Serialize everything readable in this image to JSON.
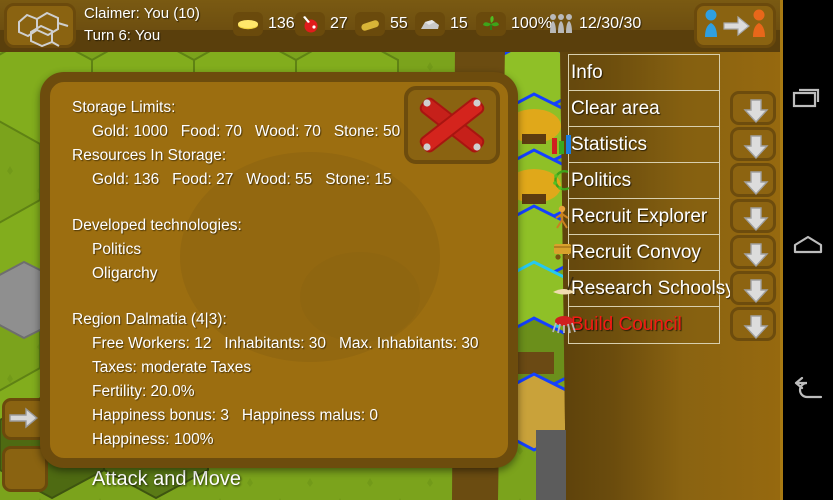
{
  "topbar": {
    "logo_icon": "hex-map-icon",
    "claimer": "Claimer: You (10)",
    "turn": "Turn 6: You",
    "resources": [
      {
        "icon": "gold-coin-icon",
        "name": "gold",
        "value": "136"
      },
      {
        "icon": "food-meat-icon",
        "name": "food",
        "value": "27"
      },
      {
        "icon": "wood-log-icon",
        "name": "wood",
        "value": "55"
      },
      {
        "icon": "stone-rock-icon",
        "name": "stone",
        "value": "15"
      },
      {
        "icon": "plant-icon",
        "name": "fertility",
        "value": "100%"
      },
      {
        "icon": "population-icon",
        "name": "population",
        "value": "12/30/30"
      }
    ],
    "end_turn_icon": "end-turn-pawns-icon"
  },
  "dialog": {
    "close_icon": "red-cross-close-icon",
    "lines": [
      {
        "text": "Storage Limits:",
        "indent": false
      },
      {
        "text": "Gold: 1000   Food: 70   Wood: 70   Stone: 50",
        "indent": true
      },
      {
        "text": "Resources In Storage:",
        "indent": false
      },
      {
        "text": "Gold: 136   Food: 27   Wood: 55   Stone: 15",
        "indent": true
      },
      {
        "text": "",
        "indent": false
      },
      {
        "text": "Developed technologies:",
        "indent": false
      },
      {
        "text": "Politics",
        "indent": true
      },
      {
        "text": "Oligarchy",
        "indent": true
      },
      {
        "text": "",
        "indent": false
      },
      {
        "text": "Region Dalmatia (4|3):",
        "indent": false
      },
      {
        "text": "Free Workers: 12   Inhabitants: 30   Max. Inhabitants: 30",
        "indent": true
      },
      {
        "text": "Taxes: moderate Taxes",
        "indent": true
      },
      {
        "text": "Fertility: 20.0%",
        "indent": true
      },
      {
        "text": "Happiness bonus: 3   Happiness malus: 0",
        "indent": true
      },
      {
        "text": "Happiness: 100%",
        "indent": true
      }
    ]
  },
  "menu": {
    "items": [
      {
        "label": "Info",
        "icon": "",
        "red": false,
        "has_arrow": false
      },
      {
        "label": "Clear area",
        "icon": "",
        "red": false,
        "has_arrow": true
      },
      {
        "label": "Statistics",
        "icon": "bar-chart-icon",
        "red": false,
        "has_arrow": true
      },
      {
        "label": "Politics",
        "icon": "laurel-wreath-icon",
        "red": false,
        "has_arrow": true
      },
      {
        "label": "Recruit Explorer",
        "icon": "explorer-icon",
        "red": false,
        "has_arrow": true
      },
      {
        "label": "Recruit Convoy",
        "icon": "convoy-cart-icon",
        "red": false,
        "has_arrow": true
      },
      {
        "label": "Research Schoolsystem",
        "icon": "scroll-quill-icon",
        "red": false,
        "has_arrow": true
      },
      {
        "label": "Build Council",
        "icon": "council-tent-icon",
        "red": true,
        "has_arrow": true
      }
    ],
    "arrow_icon": "down-arrow-icon",
    "disabled_color": "#f41a14"
  },
  "map": {
    "bottom_label": "Attack and Move",
    "left_arrow_icon": "right-arrow-icon"
  },
  "navbar": {
    "recents_icon": "recents-icon",
    "home_icon": "home-icon",
    "back_icon": "back-icon"
  }
}
